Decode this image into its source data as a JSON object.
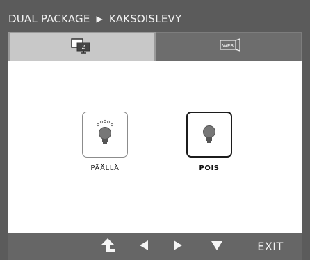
{
  "title": {
    "section": "DUAL PACKAGE",
    "separator": "▶",
    "page": "KAKSOISLEVY"
  },
  "tabs": [
    {
      "icon": "dual-monitor-icon",
      "badge": "2",
      "active": true
    },
    {
      "icon": "web-icon",
      "badge": "WEB",
      "active": false
    }
  ],
  "options": [
    {
      "label": "PÄÄLLÄ",
      "icon": "bulb-on-icon",
      "selected": false
    },
    {
      "label": "POIS",
      "icon": "bulb-off-icon",
      "selected": true
    }
  ],
  "footer": {
    "exit_label": "EXIT"
  },
  "colors": {
    "frame": "#5b5b5b",
    "active_tab": "#c8c8c8",
    "inactive_tab": "#6d6d6d",
    "content": "#ffffff"
  }
}
